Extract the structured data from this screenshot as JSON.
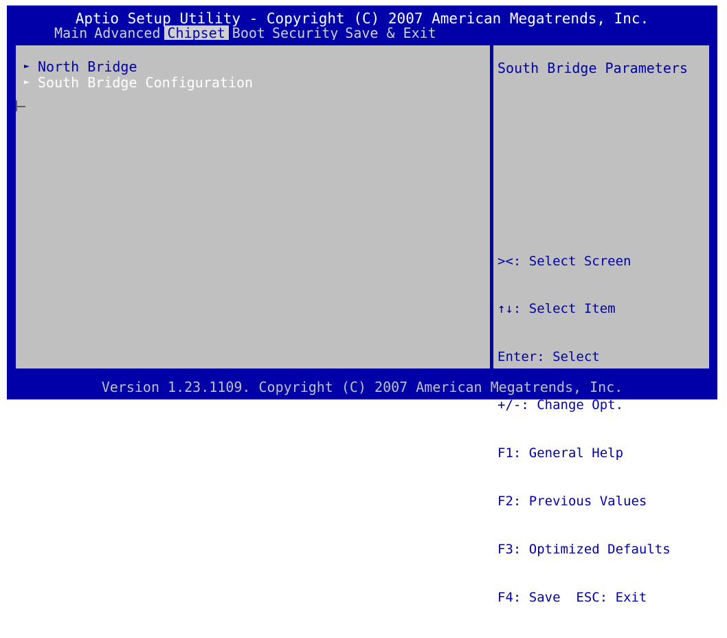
{
  "header": {
    "title": "Aptio Setup Utility - Copyright (C) 2007 American Megatrends, Inc.",
    "tabs": [
      {
        "label": "Main"
      },
      {
        "label": "Advanced"
      },
      {
        "label": "Chipset"
      },
      {
        "label": "Boot"
      },
      {
        "label": "Security"
      },
      {
        "label": "Save & Exit"
      }
    ],
    "active_tab": "Chipset"
  },
  "menu": {
    "items": [
      {
        "label": "North Bridge",
        "arrow": "►"
      },
      {
        "label": "South Bridge Configuration",
        "arrow": "►"
      }
    ],
    "selected": "South Bridge Configuration"
  },
  "help": {
    "title": "South Bridge Parameters",
    "keys": [
      "><: Select Screen",
      "↑↓: Select Item",
      "Enter: Select",
      "+/-: Change Opt.",
      "F1: General Help",
      "F2: Previous Values",
      "F3: Optimized Defaults",
      "F4: Save  ESC: Exit"
    ]
  },
  "footer": {
    "text": "Version 1.23.1109. Copyright (C) 2007 American Megatrends, Inc."
  },
  "colors": {
    "bios_blue": "#0000a8",
    "panel_gray": "#c0c0c0",
    "highlight_white": "#ffffff"
  }
}
